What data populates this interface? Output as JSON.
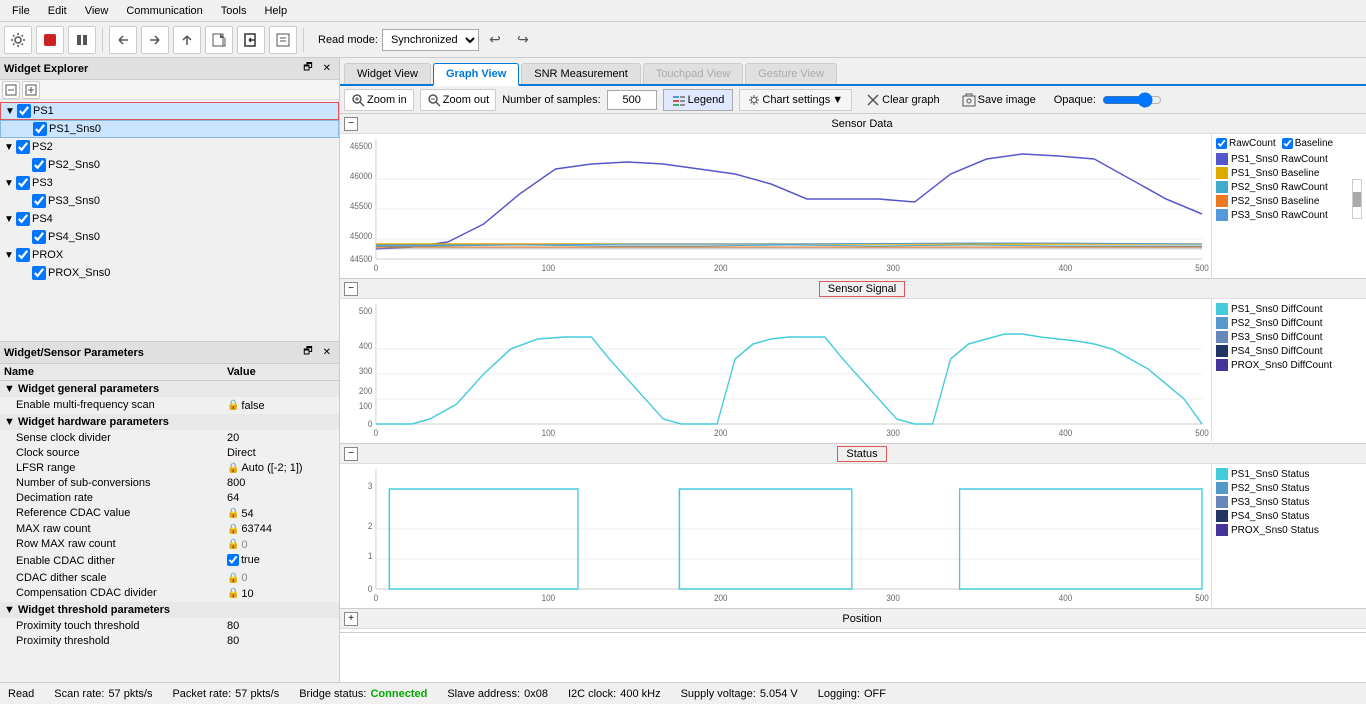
{
  "menubar": {
    "items": [
      "File",
      "Edit",
      "View",
      "Communication",
      "Tools",
      "Help"
    ]
  },
  "toolbar": {
    "read_mode_label": "Read mode:",
    "read_mode_value": "Synchronized",
    "undo_label": "↩",
    "redo_label": "↪"
  },
  "left_panel": {
    "widget_explorer": {
      "title": "Widget Explorer",
      "widgets": [
        {
          "id": "PS1",
          "label": "PS1",
          "highlighted": true,
          "children": [
            {
              "label": "PS1_Sns0"
            }
          ]
        },
        {
          "id": "PS2",
          "label": "PS2",
          "children": [
            {
              "label": "PS2_Sns0"
            }
          ]
        },
        {
          "id": "PS3",
          "label": "PS3",
          "children": [
            {
              "label": "PS3_Sns0"
            }
          ]
        },
        {
          "id": "PS4",
          "label": "PS4",
          "children": [
            {
              "label": "PS4_Sns0"
            }
          ]
        },
        {
          "id": "PROX",
          "label": "PROX",
          "children": [
            {
              "label": "PROX_Sns0"
            }
          ]
        }
      ]
    },
    "params_panel": {
      "title": "Widget/Sensor Parameters",
      "columns": [
        "Name",
        "Value"
      ],
      "sections": [
        {
          "name": "Widget general parameters",
          "rows": [
            {
              "name": "Enable multi-frequency scan",
              "value": "false",
              "type": "lock"
            }
          ]
        },
        {
          "name": "Widget hardware parameters",
          "rows": [
            {
              "name": "Sense clock divider",
              "value": "20",
              "type": "text"
            },
            {
              "name": "Clock source",
              "value": "Direct",
              "type": "text"
            },
            {
              "name": "LFSR range",
              "value": "Auto ([-2; 1])",
              "type": "lock"
            },
            {
              "name": "Number of sub-conversions",
              "value": "800",
              "type": "text"
            },
            {
              "name": "Decimation rate",
              "value": "64",
              "type": "text"
            },
            {
              "name": "Reference CDAC value",
              "value": "54",
              "type": "lock"
            },
            {
              "name": "MAX raw count",
              "value": "63744",
              "type": "lock"
            },
            {
              "name": "Row MAX raw count",
              "value": "0",
              "type": "lock"
            },
            {
              "name": "Enable CDAC dither",
              "value": "true",
              "type": "checkbox"
            },
            {
              "name": "CDAC dither scale",
              "value": "0",
              "type": "lock"
            },
            {
              "name": "Compensation CDAC divider",
              "value": "10",
              "type": "lock"
            }
          ]
        },
        {
          "name": "Widget threshold parameters",
          "rows": [
            {
              "name": "Proximity touch threshold",
              "value": "80",
              "type": "text"
            },
            {
              "name": "Proximity threshold",
              "value": "80",
              "type": "text"
            }
          ]
        }
      ]
    }
  },
  "right_panel": {
    "tabs": [
      {
        "label": "Widget View",
        "active": false,
        "disabled": false
      },
      {
        "label": "Graph View",
        "active": true,
        "disabled": false
      },
      {
        "label": "SNR Measurement",
        "active": false,
        "disabled": false
      },
      {
        "label": "Touchpad View",
        "active": false,
        "disabled": true
      },
      {
        "label": "Gesture View",
        "active": false,
        "disabled": true
      }
    ],
    "graph_toolbar": {
      "zoom_in": "🔍 Zoom in",
      "zoom_out": "🔍 Zoom out",
      "samples_label": "Number of samples:",
      "samples_value": "500",
      "legend_label": "📊 Legend",
      "chart_settings": "Chart settings",
      "clear_graph": "Clear graph",
      "save_image": "Save image",
      "opaque_label": "Opaque:"
    },
    "charts": [
      {
        "id": "sensor_data",
        "title": "Sensor Data",
        "title_bordered": false,
        "collapsed": false,
        "y_min": 44500,
        "y_max": 46500,
        "legend_checkboxes": [
          {
            "label": "RawCount",
            "checked": true
          },
          {
            "label": "Baseline",
            "checked": true
          }
        ],
        "legend_items": [
          {
            "label": "PS1_Sns0 RawCount",
            "color": "#5555cc"
          },
          {
            "label": "PS1_Sns0 Baseline",
            "color": "#ddaa00"
          },
          {
            "label": "PS2_Sns0 RawCount",
            "color": "#44aacc"
          },
          {
            "label": "PS2_Sns0 Baseline",
            "color": "#ee7722"
          },
          {
            "label": "PS3_Sns0 RawCount",
            "color": "#5599dd"
          }
        ]
      },
      {
        "id": "sensor_signal",
        "title": "Sensor Signal",
        "title_bordered": true,
        "collapsed": false,
        "y_min": 0,
        "y_max": 500,
        "legend_items": [
          {
            "label": "PS1_Sns0 DiffCount",
            "color": "#44ccdd"
          },
          {
            "label": "PS2_Sns0 DiffCount",
            "color": "#5599cc"
          },
          {
            "label": "PS3_Sns0 DiffCount",
            "color": "#6688bb"
          },
          {
            "label": "PS4_Sns0 DiffCount",
            "color": "#223366"
          },
          {
            "label": "PROX_Sns0 DiffCount",
            "color": "#443399"
          }
        ]
      },
      {
        "id": "status",
        "title": "Status",
        "title_bordered": true,
        "collapsed": false,
        "y_min": 0,
        "y_max": 3,
        "legend_items": [
          {
            "label": "PS1_Sns0 Status",
            "color": "#44ccdd"
          },
          {
            "label": "PS2_Sns0 Status",
            "color": "#5599cc"
          },
          {
            "label": "PS3_Sns0 Status",
            "color": "#6688bb"
          },
          {
            "label": "PS4_Sns0 Status",
            "color": "#223366"
          },
          {
            "label": "PROX_Sns0 Status",
            "color": "#443399"
          }
        ]
      },
      {
        "id": "position",
        "title": "Position",
        "title_bordered": false,
        "collapsed": true
      }
    ]
  },
  "status_bar": {
    "read_label": "Read",
    "scan_rate_label": "Scan rate:",
    "scan_rate_value": "57 pkts/s",
    "packet_rate_label": "Packet rate:",
    "packet_rate_value": "57 pkts/s",
    "bridge_status_label": "Bridge status:",
    "bridge_status_value": "Connected",
    "slave_address_label": "Slave address:",
    "slave_address_value": "0x08",
    "i2c_clock_label": "I2C clock:",
    "i2c_clock_value": "400 kHz",
    "supply_voltage_label": "Supply voltage:",
    "supply_voltage_value": "5.054 V",
    "logging_label": "Logging:",
    "logging_value": "OFF"
  }
}
